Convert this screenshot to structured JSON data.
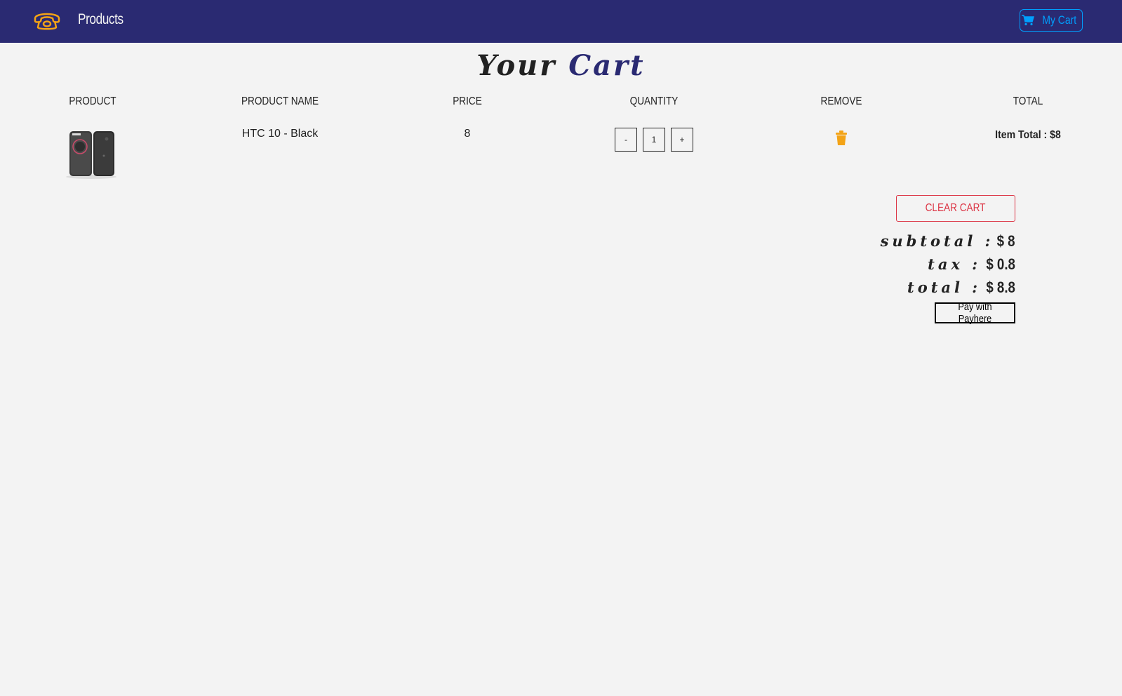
{
  "navbar": {
    "brand_link": "Products",
    "cart_button": "My Cart",
    "logo_icon": "phone-icon",
    "cart_icon": "cart-icon"
  },
  "page": {
    "title_word1": "Your",
    "title_word2": "Cart"
  },
  "columns": [
    "PRODUCT",
    "PRODUCT NAME",
    "PRICE",
    "QUANTITY",
    "REMOVE",
    "TOTAL"
  ],
  "items": [
    {
      "name": "HTC 10 - Black",
      "price": "8",
      "quantity": "1",
      "decrement": "-",
      "increment": "+",
      "item_total": "Item Total : $8",
      "remove_icon": "trash-icon"
    }
  ],
  "summary": {
    "clear_cart": "CLEAR CART",
    "subtotal_label": "subtotal :",
    "subtotal_value": "$ 8",
    "tax_label": "tax :",
    "tax_value": "$ 0.8",
    "total_label": "total :",
    "total_value": "$ 8.8",
    "pay_button": "Pay with Payhere"
  },
  "colors": {
    "navbar": "#2a2a72",
    "accent": "#009ffd",
    "icon_orange": "#f3a316",
    "danger": "#dc3545",
    "background": "#f3f3f3"
  }
}
